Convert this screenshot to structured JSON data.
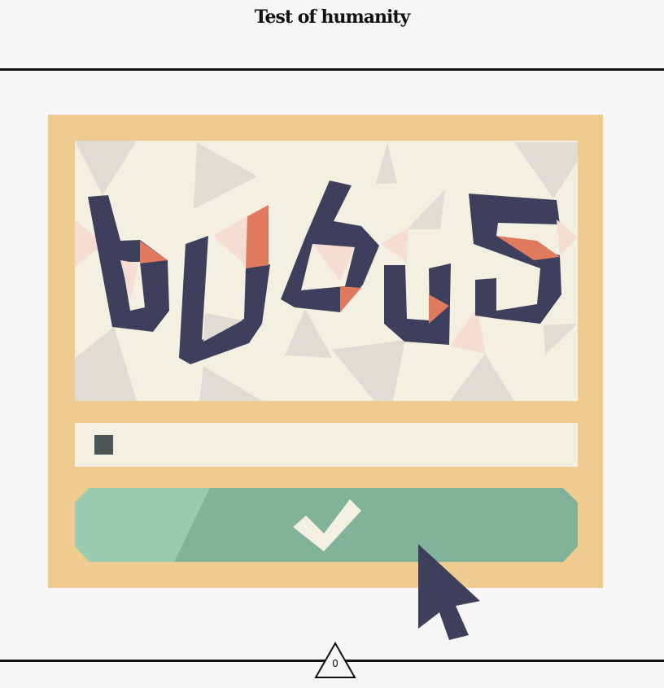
{
  "header": {
    "title": "Test of humanity"
  },
  "captcha": {
    "text": "bU6u5"
  },
  "input": {
    "value": ""
  },
  "submit": {
    "icon": "checkmark-icon"
  },
  "footer": {
    "counter": "0"
  },
  "colors": {
    "background": "#f7f5f6",
    "frame": "#f0cb8f",
    "captcha_bg": "#f3f0e1",
    "glyph": "#3e3f5c",
    "accent": "#e07a5f",
    "button": "#81b29a",
    "button_light": "#98cbb0",
    "check": "#f3f0e1"
  }
}
